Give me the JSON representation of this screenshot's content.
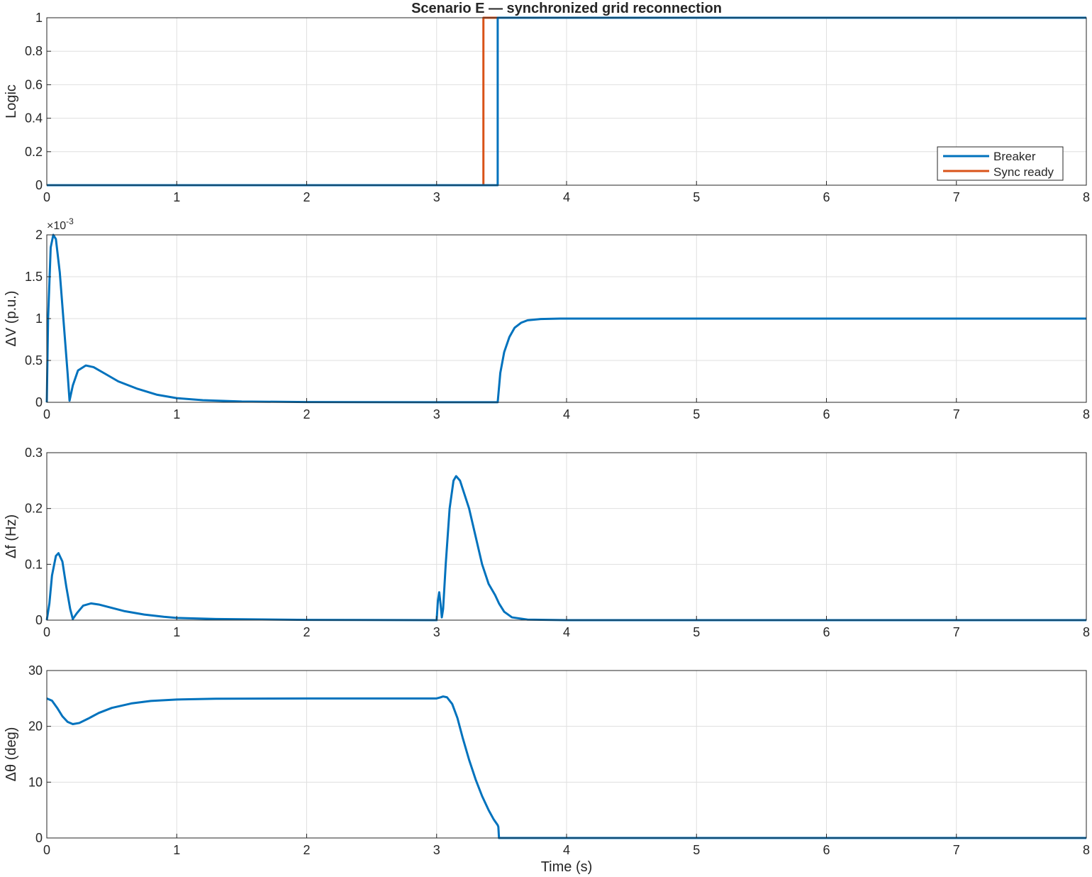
{
  "chart_data": [
    {
      "type": "line",
      "title": "Scenario E — synchronized grid reconnection",
      "xlabel": "",
      "ylabel": "Logic",
      "xlim": [
        0,
        8
      ],
      "ylim": [
        0,
        1
      ],
      "xticks": [
        "0",
        "1",
        "2",
        "3",
        "4",
        "5",
        "6",
        "7",
        "8"
      ],
      "yticks": [
        "0",
        "0.2",
        "0.4",
        "0.6",
        "0.8",
        "1"
      ],
      "grid": true,
      "legend_position": "bottom-right",
      "series": [
        {
          "name": "Breaker",
          "color": "#0072BD",
          "step": true,
          "points": [
            [
              0,
              0
            ],
            [
              3.47,
              0
            ],
            [
              3.47,
              1
            ],
            [
              8,
              1
            ]
          ]
        },
        {
          "name": "Sync ready",
          "color": "#D95319",
          "step": true,
          "points": [
            [
              0,
              0
            ],
            [
              3.36,
              0
            ],
            [
              3.36,
              1
            ],
            [
              8,
              1
            ]
          ]
        }
      ]
    },
    {
      "type": "line",
      "ylabel": "ΔV (p.u.)",
      "xlim": [
        0,
        8
      ],
      "ylim": [
        0,
        2
      ],
      "y_multiplier": "×10",
      "y_multiplier_exponent": "-3",
      "xticks": [
        "0",
        "1",
        "2",
        "3",
        "4",
        "5",
        "6",
        "7",
        "8"
      ],
      "yticks": [
        "0",
        "0.5",
        "1",
        "1.5",
        "2"
      ],
      "grid": true,
      "series": [
        {
          "color": "#0072BD",
          "points": [
            [
              0,
              0
            ],
            [
              0.01,
              1.0
            ],
            [
              0.03,
              1.85
            ],
            [
              0.05,
              2.0
            ],
            [
              0.07,
              1.95
            ],
            [
              0.1,
              1.55
            ],
            [
              0.13,
              0.95
            ],
            [
              0.16,
              0.35
            ],
            [
              0.175,
              0.02
            ],
            [
              0.2,
              0.2
            ],
            [
              0.24,
              0.38
            ],
            [
              0.3,
              0.44
            ],
            [
              0.36,
              0.42
            ],
            [
              0.45,
              0.34
            ],
            [
              0.55,
              0.25
            ],
            [
              0.7,
              0.16
            ],
            [
              0.85,
              0.09
            ],
            [
              1.0,
              0.05
            ],
            [
              1.2,
              0.025
            ],
            [
              1.5,
              0.01
            ],
            [
              2.0,
              0.003
            ],
            [
              3.0,
              0.001
            ],
            [
              3.47,
              0.001
            ],
            [
              3.49,
              0.35
            ],
            [
              3.52,
              0.6
            ],
            [
              3.56,
              0.78
            ],
            [
              3.6,
              0.89
            ],
            [
              3.65,
              0.95
            ],
            [
              3.7,
              0.98
            ],
            [
              3.8,
              0.995
            ],
            [
              3.95,
              1.0
            ],
            [
              8,
              1.0
            ]
          ]
        }
      ]
    },
    {
      "type": "line",
      "ylabel": "Δf (Hz)",
      "xlim": [
        0,
        8
      ],
      "ylim": [
        0,
        0.3
      ],
      "xticks": [
        "0",
        "1",
        "2",
        "3",
        "4",
        "5",
        "6",
        "7",
        "8"
      ],
      "yticks": [
        "0",
        "0.1",
        "0.2",
        "0.3"
      ],
      "grid": true,
      "series": [
        {
          "color": "#0072BD",
          "points": [
            [
              0,
              0
            ],
            [
              0.02,
              0.03
            ],
            [
              0.04,
              0.08
            ],
            [
              0.07,
              0.115
            ],
            [
              0.09,
              0.12
            ],
            [
              0.12,
              0.105
            ],
            [
              0.15,
              0.06
            ],
            [
              0.18,
              0.02
            ],
            [
              0.2,
              0.002
            ],
            [
              0.23,
              0.012
            ],
            [
              0.28,
              0.026
            ],
            [
              0.34,
              0.03
            ],
            [
              0.4,
              0.028
            ],
            [
              0.5,
              0.022
            ],
            [
              0.6,
              0.016
            ],
            [
              0.75,
              0.01
            ],
            [
              0.9,
              0.006
            ],
            [
              1.0,
              0.004
            ],
            [
              1.3,
              0.002
            ],
            [
              2.0,
              0.0005
            ],
            [
              3.0,
              0.0
            ],
            [
              3.0,
              0.0
            ],
            [
              3.01,
              0.035
            ],
            [
              3.02,
              0.05
            ],
            [
              3.03,
              0.03
            ],
            [
              3.04,
              0.005
            ],
            [
              3.05,
              0.02
            ],
            [
              3.07,
              0.1
            ],
            [
              3.1,
              0.2
            ],
            [
              3.13,
              0.25
            ],
            [
              3.15,
              0.258
            ],
            [
              3.18,
              0.25
            ],
            [
              3.25,
              0.2
            ],
            [
              3.3,
              0.15
            ],
            [
              3.35,
              0.1
            ],
            [
              3.4,
              0.065
            ],
            [
              3.45,
              0.045
            ],
            [
              3.48,
              0.03
            ],
            [
              3.52,
              0.015
            ],
            [
              3.58,
              0.005
            ],
            [
              3.7,
              0.001
            ],
            [
              4.0,
              0.0
            ],
            [
              8,
              0.0
            ]
          ]
        }
      ]
    },
    {
      "type": "line",
      "ylabel": "Δθ (deg)",
      "xlabel": "Time (s)",
      "xlim": [
        0,
        8
      ],
      "ylim": [
        0,
        30
      ],
      "xticks": [
        "0",
        "1",
        "2",
        "3",
        "4",
        "5",
        "6",
        "7",
        "8"
      ],
      "yticks": [
        "0",
        "10",
        "20",
        "30"
      ],
      "grid": true,
      "series": [
        {
          "color": "#0072BD",
          "points": [
            [
              0,
              25.0
            ],
            [
              0.04,
              24.6
            ],
            [
              0.08,
              23.3
            ],
            [
              0.12,
              21.8
            ],
            [
              0.16,
              20.8
            ],
            [
              0.2,
              20.4
            ],
            [
              0.25,
              20.6
            ],
            [
              0.32,
              21.4
            ],
            [
              0.4,
              22.4
            ],
            [
              0.5,
              23.3
            ],
            [
              0.65,
              24.1
            ],
            [
              0.8,
              24.55
            ],
            [
              1.0,
              24.8
            ],
            [
              1.3,
              24.95
            ],
            [
              2.0,
              25.0
            ],
            [
              3.0,
              25.0
            ],
            [
              3.03,
              25.2
            ],
            [
              3.05,
              25.35
            ],
            [
              3.08,
              25.2
            ],
            [
              3.12,
              24.0
            ],
            [
              3.16,
              21.5
            ],
            [
              3.2,
              18.0
            ],
            [
              3.25,
              14.0
            ],
            [
              3.3,
              10.5
            ],
            [
              3.35,
              7.5
            ],
            [
              3.4,
              5.0
            ],
            [
              3.44,
              3.3
            ],
            [
              3.47,
              2.3
            ],
            [
              3.475,
              2.0
            ],
            [
              3.48,
              0.0
            ],
            [
              8,
              0.0
            ]
          ]
        }
      ]
    }
  ]
}
